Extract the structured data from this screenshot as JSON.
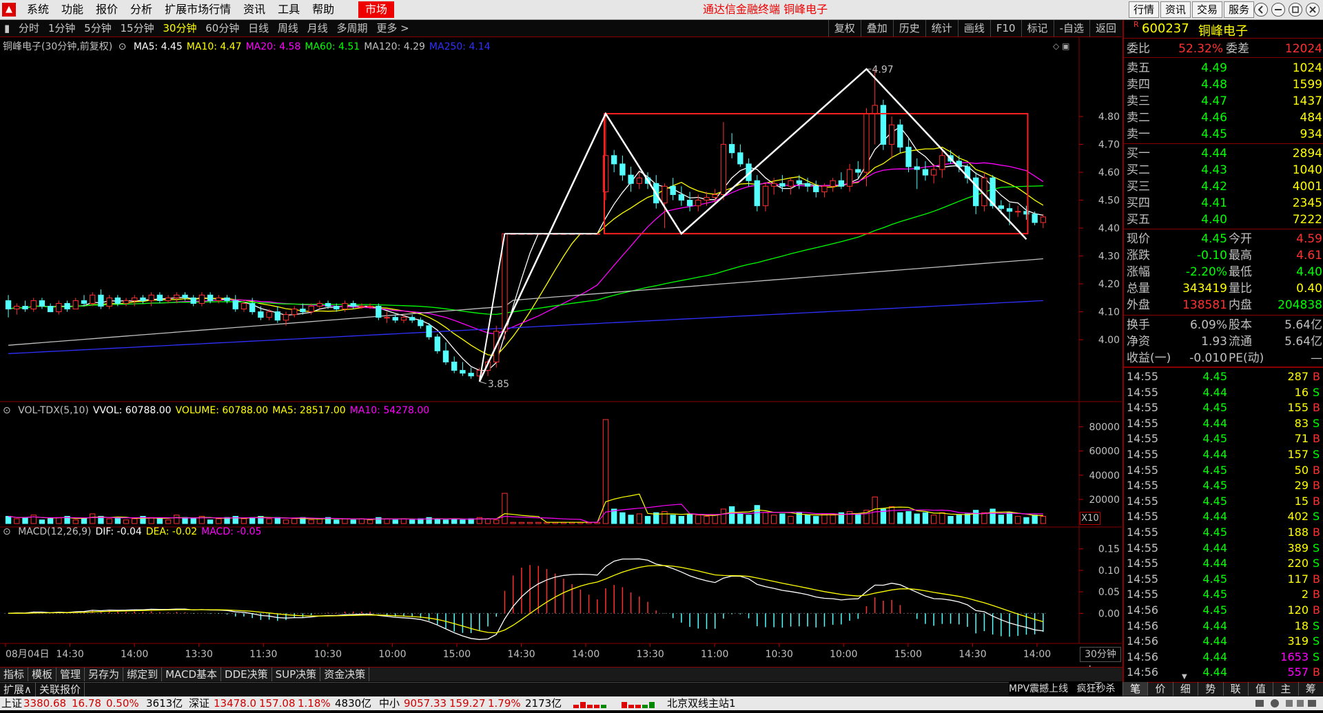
{
  "menu": [
    "系统",
    "功能",
    "报价",
    "分析",
    "扩展市场行情",
    "资讯",
    "工具",
    "帮助"
  ],
  "market_button": "市场",
  "app_title": "通达信金融终端  铜峰电子",
  "right_buttons": [
    "行情",
    "资讯",
    "交易",
    "服务"
  ],
  "periods": [
    "分时",
    "1分钟",
    "5分钟",
    "15分钟",
    "30分钟",
    "60分钟",
    "日线",
    "周线",
    "月线",
    "多周期",
    "更多 >"
  ],
  "active_period": "30分钟",
  "tools": [
    "复权",
    "叠加",
    "历史",
    "统计",
    "画线",
    "F10",
    "标记",
    "-自选",
    "返回"
  ],
  "chart_data": [
    {
      "type": "candlestick",
      "legend_title": "铜峰电子(30分钟,前复权)",
      "ma_legend": [
        {
          "label": "MA5: 4.45",
          "color": "#ffffff"
        },
        {
          "label": "MA10: 4.47",
          "color": "#ffff00"
        },
        {
          "label": "MA20: 4.58",
          "color": "#ff00ff"
        },
        {
          "label": "MA60: 4.51",
          "color": "#00ff00"
        },
        {
          "label": "MA120: 4.29",
          "color": "#c0c0c0"
        },
        {
          "label": "MA250: 4.14",
          "color": "#3030ff"
        }
      ],
      "y_ticks": [
        "4.80",
        "4.70",
        "4.60",
        "4.50",
        "4.40",
        "4.30",
        "4.20",
        "4.10",
        "4.00"
      ],
      "ylim": [
        3.82,
        5.02
      ],
      "annotations": [
        "4.97",
        "3.85"
      ],
      "candles": [
        [
          4.14,
          4.16,
          4.08,
          4.11
        ],
        [
          4.11,
          4.13,
          4.09,
          4.12
        ],
        [
          4.12,
          4.14,
          4.1,
          4.11
        ],
        [
          4.11,
          4.15,
          4.1,
          4.14
        ],
        [
          4.14,
          4.15,
          4.11,
          4.12
        ],
        [
          4.12,
          4.13,
          4.1,
          4.1
        ],
        [
          4.1,
          4.14,
          4.09,
          4.13
        ],
        [
          4.13,
          4.14,
          4.1,
          4.11
        ],
        [
          4.11,
          4.15,
          4.11,
          4.14
        ],
        [
          4.14,
          4.16,
          4.12,
          4.13
        ],
        [
          4.13,
          4.17,
          4.12,
          4.16
        ],
        [
          4.16,
          4.18,
          4.11,
          4.12
        ],
        [
          4.12,
          4.16,
          4.11,
          4.15
        ],
        [
          4.15,
          4.16,
          4.12,
          4.13
        ],
        [
          4.13,
          4.15,
          4.12,
          4.14
        ],
        [
          4.14,
          4.16,
          4.12,
          4.15
        ],
        [
          4.15,
          4.16,
          4.13,
          4.14
        ],
        [
          4.14,
          4.17,
          4.12,
          4.16
        ],
        [
          4.16,
          4.17,
          4.13,
          4.14
        ],
        [
          4.14,
          4.16,
          4.13,
          4.15
        ],
        [
          4.15,
          4.17,
          4.13,
          4.16
        ],
        [
          4.16,
          4.17,
          4.14,
          4.15
        ],
        [
          4.15,
          4.16,
          4.12,
          4.13
        ],
        [
          4.13,
          4.17,
          4.12,
          4.16
        ],
        [
          4.16,
          4.17,
          4.13,
          4.14
        ],
        [
          4.14,
          4.16,
          4.13,
          4.15
        ],
        [
          4.15,
          4.16,
          4.13,
          4.14
        ],
        [
          4.14,
          4.16,
          4.1,
          4.11
        ],
        [
          4.11,
          4.14,
          4.1,
          4.13
        ],
        [
          4.13,
          4.15,
          4.09,
          4.1
        ],
        [
          4.1,
          4.12,
          4.07,
          4.08
        ],
        [
          4.08,
          4.11,
          4.07,
          4.1
        ],
        [
          4.1,
          4.12,
          4.06,
          4.07
        ],
        [
          4.07,
          4.1,
          4.05,
          4.09
        ],
        [
          4.09,
          4.12,
          4.08,
          4.11
        ],
        [
          4.11,
          4.13,
          4.09,
          4.1
        ],
        [
          4.1,
          4.13,
          4.09,
          4.12
        ],
        [
          4.12,
          4.14,
          4.11,
          4.13
        ],
        [
          4.13,
          4.14,
          4.11,
          4.12
        ],
        [
          4.12,
          4.13,
          4.1,
          4.11
        ],
        [
          4.11,
          4.14,
          4.1,
          4.13
        ],
        [
          4.13,
          4.14,
          4.11,
          4.12
        ],
        [
          4.12,
          4.13,
          4.11,
          4.12
        ],
        [
          4.12,
          4.13,
          4.11,
          4.12
        ],
        [
          4.12,
          4.13,
          4.07,
          4.08
        ],
        [
          4.08,
          4.1,
          4.06,
          4.08
        ],
        [
          4.08,
          4.09,
          4.06,
          4.07
        ],
        [
          4.07,
          4.09,
          4.06,
          4.08
        ],
        [
          4.08,
          4.09,
          4.06,
          4.07
        ],
        [
          4.07,
          4.08,
          4.04,
          4.05
        ],
        [
          4.05,
          4.06,
          4.0,
          4.01
        ],
        [
          4.01,
          4.02,
          3.95,
          3.96
        ],
        [
          3.96,
          3.99,
          3.91,
          3.92
        ],
        [
          3.92,
          3.94,
          3.88,
          3.89
        ],
        [
          3.89,
          3.92,
          3.87,
          3.88
        ],
        [
          3.88,
          3.9,
          3.86,
          3.87
        ],
        [
          3.87,
          3.9,
          3.85,
          3.89
        ],
        [
          3.89,
          3.93,
          3.87,
          3.92
        ],
        [
          3.92,
          4.05,
          3.9,
          4.03
        ],
        [
          4.03,
          4.38,
          4.0,
          4.38
        ],
        [
          4.38,
          4.38,
          4.38,
          4.38
        ],
        [
          4.38,
          4.38,
          4.38,
          4.38
        ],
        [
          4.38,
          4.38,
          4.38,
          4.38
        ],
        [
          4.38,
          4.38,
          4.38,
          4.38
        ],
        [
          4.38,
          4.38,
          4.38,
          4.38
        ],
        [
          4.38,
          4.38,
          4.38,
          4.38
        ],
        [
          4.38,
          4.38,
          4.38,
          4.38
        ],
        [
          4.38,
          4.38,
          4.38,
          4.38
        ],
        [
          4.38,
          4.38,
          4.38,
          4.38
        ],
        [
          4.38,
          4.38,
          4.38,
          4.38
        ],
        [
          4.38,
          4.38,
          4.38,
          4.38
        ],
        [
          4.53,
          4.81,
          4.5,
          4.66
        ],
        [
          4.66,
          4.68,
          4.6,
          4.63
        ],
        [
          4.63,
          4.66,
          4.57,
          4.59
        ],
        [
          4.59,
          4.62,
          4.53,
          4.56
        ],
        [
          4.56,
          4.6,
          4.54,
          4.58
        ],
        [
          4.58,
          4.6,
          4.54,
          4.56
        ],
        [
          4.56,
          4.59,
          4.47,
          4.49
        ],
        [
          4.49,
          4.56,
          4.4,
          4.55
        ],
        [
          4.55,
          4.58,
          4.5,
          4.52
        ],
        [
          4.52,
          4.55,
          4.48,
          4.5
        ],
        [
          4.5,
          4.53,
          4.46,
          4.48
        ],
        [
          4.48,
          4.52,
          4.46,
          4.5
        ],
        [
          4.5,
          4.53,
          4.48,
          4.51
        ],
        [
          4.51,
          4.54,
          4.49,
          4.52
        ],
        [
          4.52,
          4.78,
          4.5,
          4.7
        ],
        [
          4.7,
          4.74,
          4.65,
          4.67
        ],
        [
          4.67,
          4.7,
          4.62,
          4.63
        ],
        [
          4.63,
          4.65,
          4.55,
          4.57
        ],
        [
          4.57,
          4.59,
          4.46,
          4.48
        ],
        [
          4.48,
          4.56,
          4.46,
          4.55
        ],
        [
          4.55,
          4.58,
          4.52,
          4.56
        ],
        [
          4.56,
          4.59,
          4.53,
          4.55
        ],
        [
          4.55,
          4.58,
          4.52,
          4.57
        ],
        [
          4.57,
          4.59,
          4.54,
          4.56
        ],
        [
          4.56,
          4.58,
          4.53,
          4.55
        ],
        [
          4.55,
          4.57,
          4.51,
          4.53
        ],
        [
          4.53,
          4.56,
          4.51,
          4.55
        ],
        [
          4.55,
          4.58,
          4.53,
          4.57
        ],
        [
          4.57,
          4.6,
          4.54,
          4.55
        ],
        [
          4.55,
          4.63,
          4.53,
          4.61
        ],
        [
          4.61,
          4.64,
          4.58,
          4.6
        ],
        [
          4.6,
          4.83,
          4.55,
          4.81
        ],
        [
          4.81,
          4.97,
          4.7,
          4.84
        ],
        [
          4.84,
          4.86,
          4.68,
          4.7
        ],
        [
          4.7,
          4.8,
          4.65,
          4.77
        ],
        [
          4.77,
          4.79,
          4.67,
          4.69
        ],
        [
          4.69,
          4.72,
          4.6,
          4.62
        ],
        [
          4.62,
          4.65,
          4.54,
          4.61
        ],
        [
          4.61,
          4.64,
          4.57,
          4.59
        ],
        [
          4.59,
          4.63,
          4.56,
          4.61
        ],
        [
          4.61,
          4.68,
          4.58,
          4.66
        ],
        [
          4.66,
          4.68,
          4.63,
          4.64
        ],
        [
          4.64,
          4.66,
          4.6,
          4.62
        ],
        [
          4.62,
          4.63,
          4.56,
          4.58
        ],
        [
          4.58,
          4.6,
          4.45,
          4.48
        ],
        [
          4.48,
          4.6,
          4.46,
          4.58
        ],
        [
          4.58,
          4.59,
          4.47,
          4.48
        ],
        [
          4.48,
          4.5,
          4.45,
          4.47
        ],
        [
          4.47,
          4.49,
          4.41,
          4.46
        ],
        [
          4.46,
          4.48,
          4.44,
          4.46
        ],
        [
          4.46,
          4.48,
          4.43,
          4.45
        ],
        [
          4.45,
          4.46,
          4.41,
          4.42
        ],
        [
          4.42,
          4.45,
          4.4,
          4.44
        ]
      ]
    },
    {
      "type": "bar",
      "legend": [
        {
          "label": "VOL-TDX(5,10)",
          "color": "#c0c0c0"
        },
        {
          "label": "VVOL: 60788.00",
          "color": "#ffffff"
        },
        {
          "label": "VOLUME: 60788.00",
          "color": "#ffff00"
        },
        {
          "label": "MA5: 28517.00",
          "color": "#ffff00"
        },
        {
          "label": "MA10: 54278.00",
          "color": "#ff00ff"
        }
      ],
      "y_ticks": [
        "80000",
        "60000",
        "40000",
        "20000"
      ],
      "unit_label": "X10",
      "ylim": [
        0,
        90000
      ],
      "values": [
        6000,
        4000,
        5000,
        7000,
        3000,
        4000,
        5000,
        6000,
        3000,
        4000,
        8000,
        6000,
        4000,
        5000,
        3000,
        4000,
        6000,
        5000,
        4000,
        3000,
        7000,
        5000,
        4000,
        6000,
        3000,
        4000,
        5000,
        6000,
        4000,
        5000,
        6000,
        4000,
        5000,
        3000,
        4000,
        5000,
        3000,
        4000,
        5000,
        3000,
        4000,
        3000,
        4000,
        3000,
        5000,
        4000,
        3000,
        4000,
        3000,
        4000,
        5000,
        4000,
        3000,
        4000,
        3000,
        4000,
        5000,
        4000,
        3000,
        25000,
        1000,
        1000,
        1000,
        1000,
        1000,
        1000,
        1000,
        1000,
        1000,
        1000,
        1000,
        86000,
        12000,
        9000,
        7000,
        8000,
        6000,
        9000,
        10000,
        7000,
        6000,
        8000,
        7000,
        6000,
        7000,
        12000,
        14000,
        8000,
        7000,
        15000,
        9000,
        7000,
        8000,
        6000,
        9000,
        7000,
        6000,
        8000,
        7000,
        9000,
        10000,
        8000,
        11000,
        22000,
        12000,
        14000,
        9000,
        10000,
        8000,
        9000,
        7000,
        9000,
        6000,
        7000,
        8000,
        11000,
        9000,
        12000,
        7000,
        9000,
        6000,
        5000,
        7000,
        6000
      ]
    },
    {
      "type": "macd",
      "legend": [
        {
          "label": "MACD(12,26,9)",
          "color": "#c0c0c0"
        },
        {
          "label": "DIF: -0.04",
          "color": "#ffffff"
        },
        {
          "label": "DEA: -0.02",
          "color": "#ffff00"
        },
        {
          "label": "MACD: -0.05",
          "color": "#ff00ff"
        }
      ],
      "y_ticks": [
        "0.15",
        "0.10",
        "0.05",
        "0.00"
      ],
      "ylim": [
        -0.07,
        0.18
      ]
    }
  ],
  "x_axis_labels": [
    "08月04日",
    "14:30",
    "14:00",
    "13:30",
    "11:30",
    "10:30",
    "10:00",
    "15:00",
    "14:30",
    "14:00",
    "13:30",
    "11:00",
    "10:30",
    "10:00",
    "15:00",
    "14:30",
    "14:00"
  ],
  "period_label": "30分钟",
  "bottom_tabs": [
    "指标",
    "模板",
    "管理",
    "另存为",
    "绑定到",
    "MACD基本",
    "DDE决策",
    "SUP决策",
    "资金决策"
  ],
  "expand_tabs": [
    "扩展∧",
    "关联报价"
  ],
  "right_bottom_tabs": [
    "MPV震撼上线",
    "疯狂秒杀",
    "笔",
    "价",
    "细",
    "势",
    "联",
    "值",
    "主",
    "筹"
  ],
  "stock": {
    "code": "600237",
    "name": "铜峰电子",
    "badge": "R"
  },
  "order_book": {
    "weibi_label": "委比",
    "weibi": "52.32%",
    "weicha_label": "委差",
    "weicha": "12024",
    "asks": [
      {
        "label": "卖五",
        "price": "4.49",
        "vol": "1024"
      },
      {
        "label": "卖四",
        "price": "4.48",
        "vol": "1599"
      },
      {
        "label": "卖三",
        "price": "4.47",
        "vol": "1437"
      },
      {
        "label": "卖二",
        "price": "4.46",
        "vol": "484"
      },
      {
        "label": "卖一",
        "price": "4.45",
        "vol": "934"
      }
    ],
    "bids": [
      {
        "label": "买一",
        "price": "4.44",
        "vol": "2894"
      },
      {
        "label": "买二",
        "price": "4.43",
        "vol": "1040"
      },
      {
        "label": "买三",
        "price": "4.42",
        "vol": "4001"
      },
      {
        "label": "买四",
        "price": "4.41",
        "vol": "2345"
      },
      {
        "label": "买五",
        "price": "4.40",
        "vol": "7222"
      }
    ]
  },
  "quote": [
    {
      "l1": "现价",
      "v1": "4.45",
      "c1": "#00ff00",
      "l2": "今开",
      "v2": "4.59",
      "c2": "#ff3030"
    },
    {
      "l1": "涨跌",
      "v1": "-0.10",
      "c1": "#00ff00",
      "l2": "最高",
      "v2": "4.61",
      "c2": "#ff3030"
    },
    {
      "l1": "涨幅",
      "v1": "-2.20%",
      "c1": "#00ff00",
      "l2": "最低",
      "v2": "4.40",
      "c2": "#00ff00"
    },
    {
      "l1": "总量",
      "v1": "343419",
      "c1": "#ffff00",
      "l2": "量比",
      "v2": "0.40",
      "c2": "#ffff00"
    },
    {
      "l1": "外盘",
      "v1": "138581",
      "c1": "#ff3030",
      "l2": "内盘",
      "v2": "204838",
      "c2": "#00ff00"
    }
  ],
  "fundamentals": [
    {
      "l1": "换手",
      "v1": "6.09%",
      "l2": "股本",
      "v2": "5.64亿"
    },
    {
      "l1": "净资",
      "v1": "1.93",
      "l2": "流通",
      "v2": "5.64亿"
    },
    {
      "l1": "收益(一)",
      "v1": "-0.010",
      "l2": "PE(动)",
      "v2": "—"
    }
  ],
  "ticks": [
    {
      "t": "14:55",
      "p": "4.45",
      "v": "287",
      "bs": "B"
    },
    {
      "t": "14:55",
      "p": "4.44",
      "v": "16",
      "bs": "S"
    },
    {
      "t": "14:55",
      "p": "4.45",
      "v": "155",
      "bs": "B"
    },
    {
      "t": "14:55",
      "p": "4.44",
      "v": "83",
      "bs": "S"
    },
    {
      "t": "14:55",
      "p": "4.45",
      "v": "71",
      "bs": "B"
    },
    {
      "t": "14:55",
      "p": "4.44",
      "v": "157",
      "bs": "S"
    },
    {
      "t": "14:55",
      "p": "4.45",
      "v": "50",
      "bs": "B"
    },
    {
      "t": "14:55",
      "p": "4.45",
      "v": "29",
      "bs": "B"
    },
    {
      "t": "14:55",
      "p": "4.45",
      "v": "15",
      "bs": "B"
    },
    {
      "t": "14:55",
      "p": "4.44",
      "v": "402",
      "bs": "S"
    },
    {
      "t": "14:55",
      "p": "4.45",
      "v": "188",
      "bs": "B"
    },
    {
      "t": "14:55",
      "p": "4.44",
      "v": "389",
      "bs": "S"
    },
    {
      "t": "14:55",
      "p": "4.44",
      "v": "220",
      "bs": "S"
    },
    {
      "t": "14:55",
      "p": "4.45",
      "v": "117",
      "bs": "B"
    },
    {
      "t": "14:55",
      "p": "4.45",
      "v": "2",
      "bs": "B"
    },
    {
      "t": "14:56",
      "p": "4.45",
      "v": "120",
      "bs": "B"
    },
    {
      "t": "14:56",
      "p": "4.44",
      "v": "18",
      "bs": "S"
    },
    {
      "t": "14:56",
      "p": "4.44",
      "v": "319",
      "bs": "S"
    },
    {
      "t": "14:56",
      "p": "4.44",
      "v": "1653",
      "bs": "S"
    },
    {
      "t": "14:56",
      "p": "4.44",
      "v": "557",
      "bs": "B"
    }
  ],
  "status_bar": {
    "sh_label": "上证",
    "sh_val": "3380.68",
    "sh_chg": "16.78",
    "sh_pct": "0.50%",
    "sh_amt": "3613亿",
    "sz_label": "深证",
    "sz_val": "13478.0",
    "sz_chg": "157.08",
    "sz_pct": "1.18%",
    "sz_amt": "4830亿",
    "zx_label": "中小",
    "zx_val": "9057.33",
    "zx_chg": "159.27",
    "zx_pct": "1.79%",
    "zx_amt": "2173亿",
    "server": "北京双线主站1"
  }
}
